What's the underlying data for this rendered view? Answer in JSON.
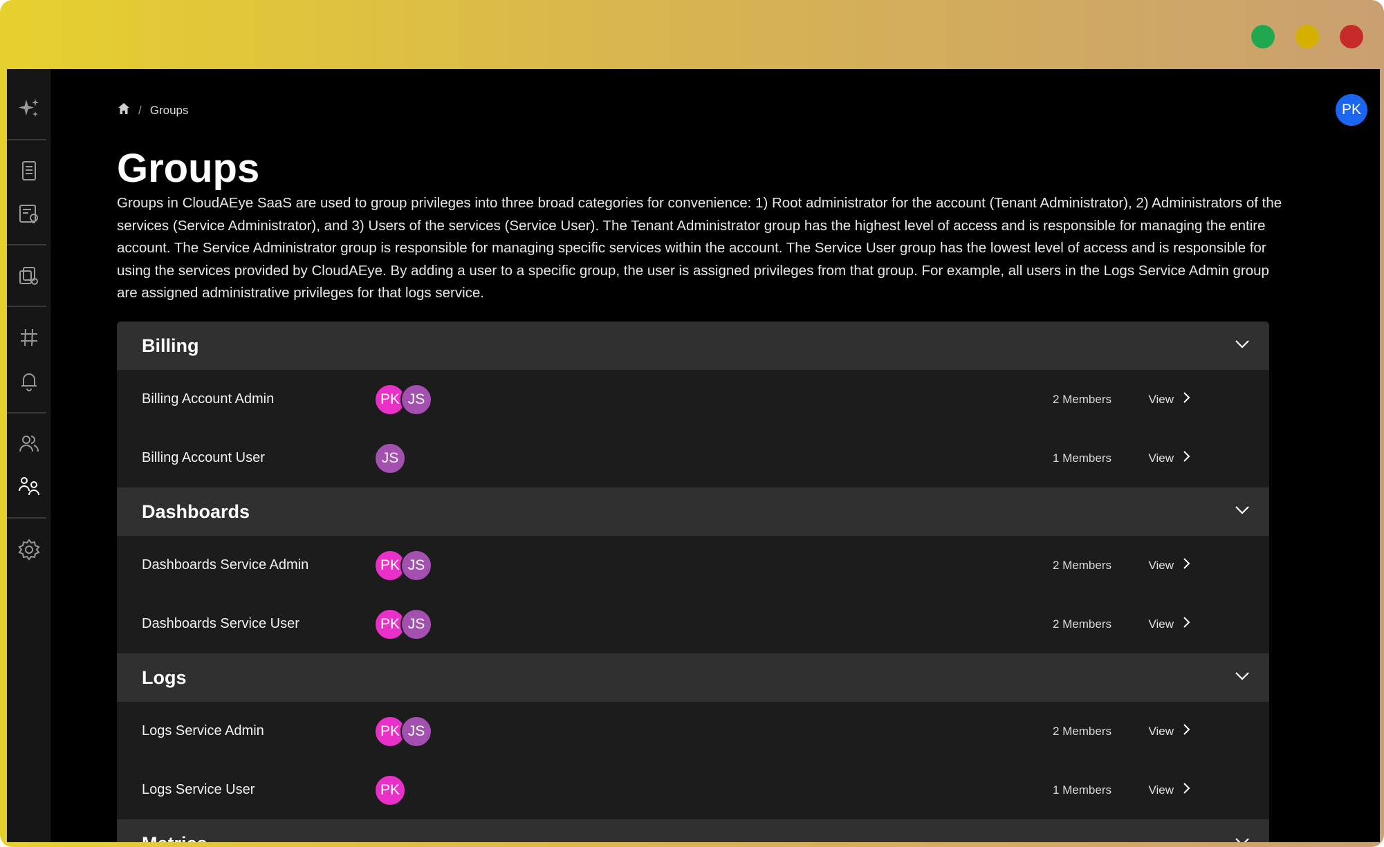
{
  "window_controls": [
    {
      "name": "maximize",
      "color": "#1fa84f"
    },
    {
      "name": "minimize",
      "color": "#d4b000"
    },
    {
      "name": "close",
      "color": "#c72a2a"
    }
  ],
  "sidebar": {
    "items": [
      {
        "icon": "sparkles-icon"
      },
      {
        "icon": "document-icon"
      },
      {
        "icon": "report-insights-icon"
      },
      {
        "icon": "services-settings-icon"
      },
      {
        "icon": "hashtag-icon"
      },
      {
        "icon": "bell-icon"
      },
      {
        "icon": "users-icon"
      },
      {
        "icon": "groups-icon"
      },
      {
        "icon": "gear-icon"
      }
    ]
  },
  "breadcrumb": {
    "home_icon": "home-icon",
    "separator": "/",
    "current": "Groups"
  },
  "user": {
    "initials": "PK",
    "color": "#1a66f0"
  },
  "page": {
    "title": "Groups",
    "description": "Groups in CloudAEye SaaS are used to group privileges into three broad categories for convenience: 1) Root administrator for the account (Tenant Administrator), 2) Administrators of the services (Service Administrator), and 3) Users of the services (Service User). The Tenant Administrator group has the highest level of access and is responsible for managing the entire account. The Service Administrator group is responsible for managing specific services within the account. The Service User group has the lowest level of access and is responsible for using the services provided by CloudAEye. By adding a user to a specific group, the user is assigned privileges from that group. For example, all users in the Logs Service Admin group are assigned administrative privileges for that logs service."
  },
  "sections": [
    {
      "title": "Billing",
      "rows": [
        {
          "name": "Billing Account Admin",
          "avatars": [
            "PK",
            "JS"
          ],
          "members": "2 Members",
          "action": "View"
        },
        {
          "name": "Billing Account User",
          "avatars": [
            "JS"
          ],
          "members": "1 Members",
          "action": "View"
        }
      ]
    },
    {
      "title": "Dashboards",
      "rows": [
        {
          "name": "Dashboards Service Admin",
          "avatars": [
            "PK",
            "JS"
          ],
          "members": "2 Members",
          "action": "View"
        },
        {
          "name": "Dashboards Service User",
          "avatars": [
            "PK",
            "JS"
          ],
          "members": "2 Members",
          "action": "View"
        }
      ]
    },
    {
      "title": "Logs",
      "rows": [
        {
          "name": "Logs Service Admin",
          "avatars": [
            "PK",
            "JS"
          ],
          "members": "2 Members",
          "action": "View"
        },
        {
          "name": "Logs Service User",
          "avatars": [
            "PK"
          ],
          "members": "1 Members",
          "action": "View"
        }
      ]
    },
    {
      "title": "Metrics",
      "rows": []
    }
  ],
  "colors": {
    "avatar_pk": "#e930c8",
    "avatar_js": "#a450b0",
    "section_header": "#303030",
    "row_bg": "#1c1c1c"
  }
}
